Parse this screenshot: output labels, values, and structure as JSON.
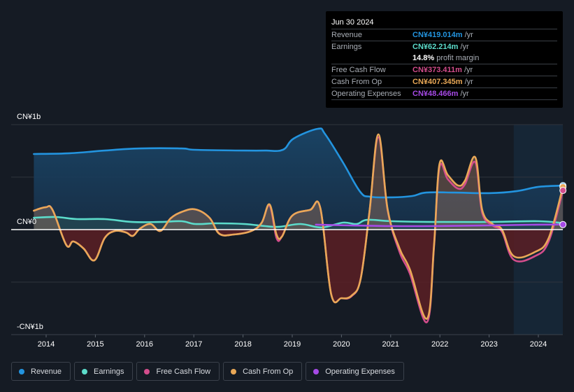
{
  "tooltip": {
    "date": "Jun 30 2024",
    "rows": [
      {
        "label": "Revenue",
        "value": "CN¥419.014m",
        "unit": "/yr",
        "color": "#2394df"
      },
      {
        "label": "Earnings",
        "value": "CN¥62.214m",
        "unit": "/yr",
        "color": "#5cdccb"
      },
      {
        "label": "",
        "value": "14.8%",
        "unit": "profit margin",
        "color": "#ffffff"
      },
      {
        "label": "Free Cash Flow",
        "value": "CN¥373.411m",
        "unit": "/yr",
        "color": "#d34d8c"
      },
      {
        "label": "Cash From Op",
        "value": "CN¥407.345m",
        "unit": "/yr",
        "color": "#e9a857"
      },
      {
        "label": "Operating Expenses",
        "value": "CN¥48.466m",
        "unit": "/yr",
        "color": "#a64ae6"
      }
    ]
  },
  "legend": [
    {
      "label": "Revenue",
      "color": "#2394df"
    },
    {
      "label": "Earnings",
      "color": "#5cdccb"
    },
    {
      "label": "Free Cash Flow",
      "color": "#d34d8c"
    },
    {
      "label": "Cash From Op",
      "color": "#e9a857"
    },
    {
      "label": "Operating Expenses",
      "color": "#a64ae6"
    }
  ],
  "chart_data": {
    "type": "area",
    "title": "",
    "xlabel": "",
    "ylabel": "",
    "unit": "CN¥ millions",
    "ylim": [
      -1000,
      1000
    ],
    "xlim": [
      2013.75,
      2024.5
    ],
    "y_ticks": [
      {
        "value": 1000,
        "label": "CN¥1b"
      },
      {
        "value": 0,
        "label": "CN¥0"
      },
      {
        "value": -1000,
        "label": "-CN¥1b"
      }
    ],
    "x_ticks": [
      2014,
      2015,
      2016,
      2017,
      2018,
      2019,
      2020,
      2021,
      2022,
      2023,
      2024
    ],
    "x_tick_labels": [
      "2014",
      "2015",
      "2016",
      "2017",
      "2018",
      "2019",
      "2020",
      "2021",
      "2022",
      "2023",
      "2024"
    ],
    "highlight_from": 2023.5,
    "grid": true,
    "legend_position": "bottom",
    "series": [
      {
        "name": "Revenue",
        "color": "#2394df",
        "fill": true,
        "x": [
          2013.75,
          2014.48,
          2015.19,
          2015.9,
          2016.75,
          2017.03,
          2018.03,
          2018.45,
          2018.81,
          2019.03,
          2019.52,
          2019.67,
          2020.03,
          2020.38,
          2020.59,
          2021.02,
          2021.44,
          2021.72,
          2022.29,
          2023.0,
          2023.57,
          2024.0,
          2024.5
        ],
        "y": [
          720,
          727,
          753,
          773,
          773,
          760,
          753,
          753,
          760,
          867,
          960,
          907,
          640,
          360,
          313,
          307,
          320,
          353,
          353,
          347,
          367,
          407,
          419
        ]
      },
      {
        "name": "Earnings",
        "color": "#5cdccb",
        "fill": true,
        "x": [
          2013.75,
          2014.2,
          2014.63,
          2015.19,
          2015.75,
          2016.32,
          2016.75,
          2017.03,
          2017.46,
          2018.03,
          2018.45,
          2018.74,
          2019.17,
          2019.6,
          2020.03,
          2020.31,
          2020.52,
          2021.02,
          2021.87,
          2023.0,
          2024.0,
          2024.5
        ],
        "y": [
          113,
          120,
          100,
          100,
          73,
          73,
          80,
          53,
          60,
          53,
          33,
          27,
          53,
          20,
          67,
          53,
          93,
          80,
          73,
          73,
          80,
          62
        ]
      },
      {
        "name": "Cash From Op",
        "color": "#e9a857",
        "fill": true,
        "x": [
          2013.75,
          2013.99,
          2014.13,
          2014.41,
          2014.55,
          2014.76,
          2014.98,
          2015.19,
          2015.4,
          2015.62,
          2015.76,
          2015.9,
          2016.12,
          2016.32,
          2016.53,
          2016.75,
          2017.03,
          2017.32,
          2017.52,
          2017.81,
          2018.17,
          2018.38,
          2018.54,
          2018.68,
          2018.79,
          2019.0,
          2019.36,
          2019.57,
          2019.79,
          2020.0,
          2020.21,
          2020.39,
          2020.57,
          2020.75,
          2020.94,
          2021.18,
          2021.39,
          2021.74,
          2021.88,
          2021.99,
          2022.16,
          2022.37,
          2022.51,
          2022.72,
          2022.86,
          2023.07,
          2023.26,
          2023.5,
          2023.93,
          2024.21,
          2024.5
        ],
        "y": [
          180,
          213,
          187,
          -147,
          -113,
          -180,
          -293,
          -80,
          -13,
          -27,
          -60,
          7,
          53,
          -13,
          107,
          167,
          193,
          113,
          -40,
          -47,
          -13,
          67,
          240,
          -47,
          -67,
          133,
          187,
          207,
          -613,
          -653,
          -627,
          -467,
          173,
          907,
          187,
          -180,
          -380,
          -847,
          -147,
          620,
          520,
          420,
          467,
          687,
          187,
          53,
          0,
          -253,
          -213,
          -80,
          407
        ]
      },
      {
        "name": "Free Cash Flow",
        "color": "#d34d8c",
        "fill": false,
        "x": [
          2013.75,
          2013.99,
          2014.13,
          2014.41,
          2014.55,
          2014.76,
          2014.98,
          2015.19,
          2015.4,
          2015.62,
          2015.76,
          2015.9,
          2016.12,
          2016.32,
          2016.53,
          2016.75,
          2017.03,
          2017.32,
          2017.52,
          2017.81,
          2018.17,
          2018.38,
          2018.54,
          2018.68,
          2018.79,
          2019.0,
          2019.36,
          2019.57,
          2019.79,
          2020.0,
          2020.21,
          2020.39,
          2020.57,
          2020.75,
          2020.94,
          2021.18,
          2021.39,
          2021.74,
          2021.88,
          2021.99,
          2022.16,
          2022.37,
          2022.51,
          2022.72,
          2022.86,
          2023.07,
          2023.26,
          2023.5,
          2023.93,
          2024.21,
          2024.5
        ],
        "y": [
          180,
          213,
          187,
          -147,
          -113,
          -180,
          -293,
          -80,
          -13,
          -27,
          -60,
          7,
          53,
          -13,
          107,
          167,
          193,
          113,
          -40,
          -47,
          -13,
          67,
          230,
          -80,
          -67,
          133,
          187,
          207,
          -613,
          -653,
          -633,
          -467,
          173,
          880,
          180,
          -213,
          -420,
          -880,
          -167,
          590,
          480,
          390,
          433,
          640,
          160,
          40,
          -20,
          -287,
          -253,
          -113,
          373
        ]
      },
      {
        "name": "Operating Expenses",
        "color": "#a64ae6",
        "fill": false,
        "x": [
          2019.48,
          2020.16,
          2021.02,
          2021.87,
          2023.0,
          2024.0,
          2024.5
        ],
        "y": [
          47,
          40,
          33,
          33,
          40,
          47,
          48
        ]
      }
    ]
  }
}
